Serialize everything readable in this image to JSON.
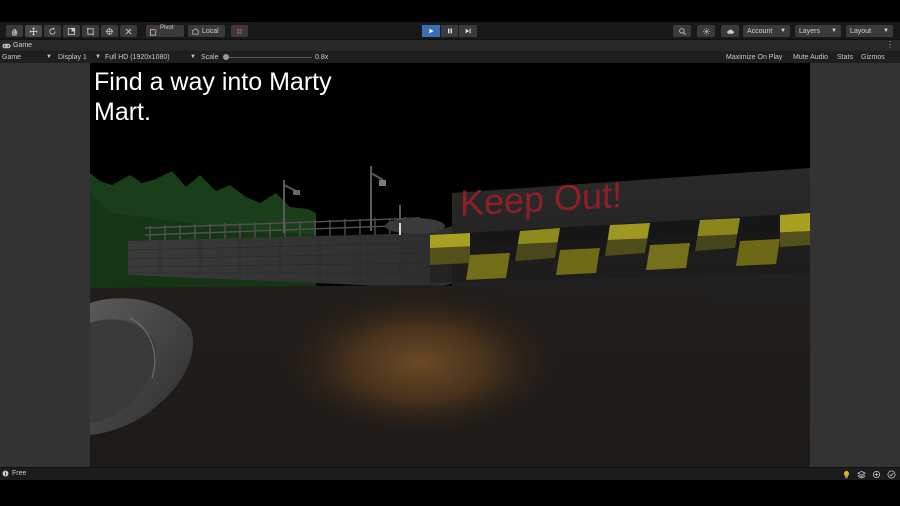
{
  "toolbar": {
    "pivot_label": "Pivot",
    "local_label": "Local",
    "account_label": "Account",
    "layers_label": "Layers",
    "layout_label": "Layout"
  },
  "tab": {
    "title": "Game"
  },
  "gamebar": {
    "mode": "Game",
    "display": "Display 1",
    "resolution": "Full HD (1920x1080)",
    "scale_label": "Scale",
    "scale_value": "0.8x",
    "maximize": "Maximize On Play",
    "mute": "Mute Audio",
    "stats": "Stats",
    "gizmos": "Gizmos"
  },
  "scene": {
    "objective_text": "Find a way into Marty Mart.",
    "sign_text": "Keep Out!"
  },
  "status": {
    "text": "Free"
  },
  "colors": {
    "play_active": "#3b6fb3",
    "sign_red": "#b0202a",
    "hazard_yellow": "#b8b020"
  }
}
